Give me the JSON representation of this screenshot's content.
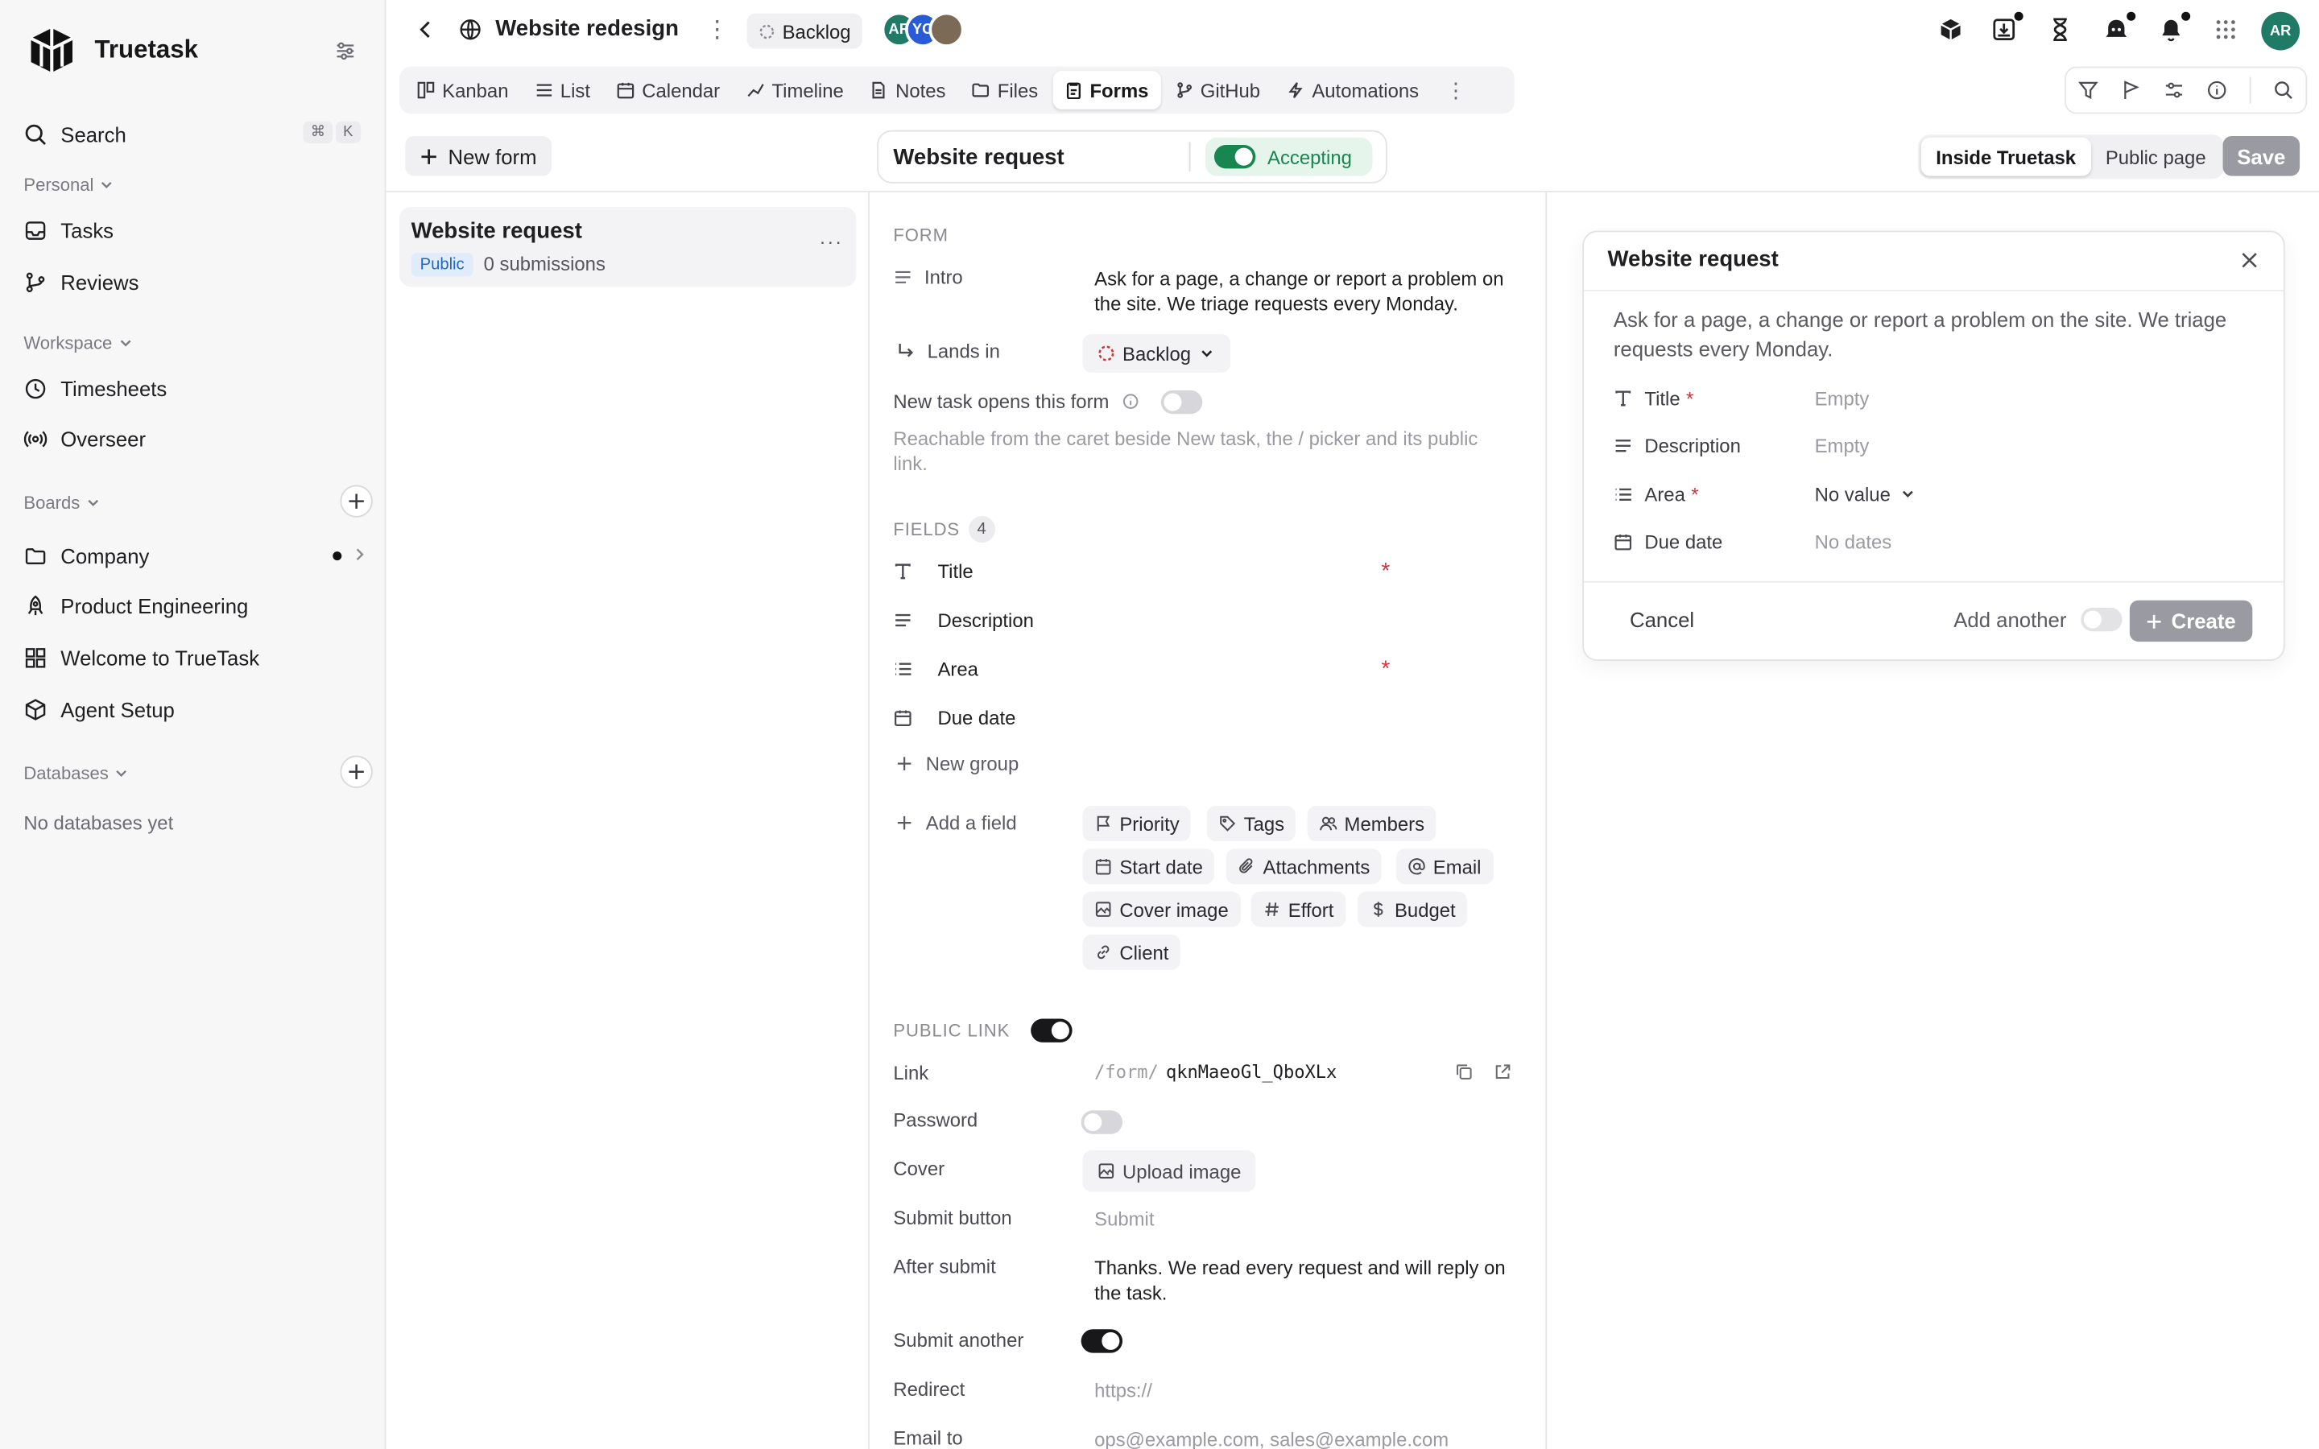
{
  "sidebar": {
    "brand": "Truetask",
    "search": {
      "label": "Search",
      "shortcut_mod": "⌘",
      "shortcut_key": "K"
    },
    "personal": {
      "title": "Personal",
      "items": [
        {
          "label": "Tasks"
        },
        {
          "label": "Reviews"
        }
      ]
    },
    "workspace": {
      "title": "Workspace",
      "items": [
        {
          "label": "Timesheets"
        },
        {
          "label": "Overseer"
        }
      ]
    },
    "boards": {
      "title": "Boards",
      "items": [
        {
          "label": "Company"
        },
        {
          "label": "Product Engineering"
        },
        {
          "label": "Welcome to TrueTask"
        },
        {
          "label": "Agent Setup"
        }
      ]
    },
    "databases": {
      "title": "Databases",
      "empty": "No databases yet"
    }
  },
  "topbar": {
    "title": "Website redesign",
    "status": "Backlog",
    "avatars": [
      {
        "initials": "AR",
        "color": "#1f7a66"
      },
      {
        "initials": "YO",
        "color": "#2a5bd7"
      },
      {
        "initials": "",
        "color": "#7b6a56"
      }
    ],
    "user_initials": "AR",
    "user_color": "#1f7a66"
  },
  "tabs": [
    {
      "label": "Kanban",
      "icon": "kanban-icon"
    },
    {
      "label": "List",
      "icon": "list-icon"
    },
    {
      "label": "Calendar",
      "icon": "calendar-icon"
    },
    {
      "label": "Timeline",
      "icon": "timeline-icon"
    },
    {
      "label": "Notes",
      "icon": "notes-icon"
    },
    {
      "label": "Files",
      "icon": "folder-icon"
    },
    {
      "label": "Forms",
      "icon": "form-icon",
      "active": true
    },
    {
      "label": "GitHub",
      "icon": "branch-icon"
    },
    {
      "label": "Automations",
      "icon": "bolt-icon"
    }
  ],
  "toolbar": {
    "new_form": "New form",
    "form_name": "Website request",
    "accepting": "Accepting",
    "view_inside": "Inside Truetask",
    "view_public": "Public page",
    "save": "Save"
  },
  "forms_list": [
    {
      "title": "Website request",
      "visibility": "Public",
      "submissions": "0 submissions"
    }
  ],
  "editor": {
    "form_section": "FORM",
    "intro_label": "Intro",
    "intro_value": "Ask for a page, a change or report a problem on the site. We triage requests every Monday.",
    "lands_in_label": "Lands in",
    "lands_in_value": "Backlog",
    "new_task_label": "New task opens this form",
    "new_task_help": "Reachable from the caret beside New task, the / picker and its public link.",
    "fields_section": "FIELDS",
    "fields_count": "4",
    "fields": [
      {
        "label": "Title",
        "icon": "text-icon",
        "required": "*"
      },
      {
        "label": "Description",
        "icon": "paragraph-icon",
        "required": ""
      },
      {
        "label": "Area",
        "icon": "list-icon",
        "required": "*"
      },
      {
        "label": "Due date",
        "icon": "calendar-icon",
        "required": ""
      }
    ],
    "new_group": "New group",
    "add_field": "Add a field",
    "chips": [
      "Priority",
      "Tags",
      "Members",
      "Start date",
      "Attachments",
      "Email",
      "Cover image",
      "Effort",
      "Budget",
      "Client"
    ],
    "public_link_section": "PUBLIC LINK",
    "link_label": "Link",
    "link_prefix": "/form/",
    "link_slug": "qknMaeoGl_QboXLx",
    "password_label": "Password",
    "cover_label": "Cover",
    "upload_image": "Upload image",
    "submit_button_label": "Submit button",
    "submit_button_placeholder": "Submit",
    "after_submit_label": "After submit",
    "after_submit_value": "Thanks. We read every request and will reply on the task.",
    "submit_another_label": "Submit another",
    "redirect_label": "Redirect",
    "redirect_placeholder": "https://",
    "email_to_label": "Email to",
    "email_to_placeholder": "ops@example.com, sales@example.com"
  },
  "preview": {
    "title": "Website request",
    "description": "Ask for a page, a change or report a problem on the site. We triage requests every Monday.",
    "fields": [
      {
        "label": "Title",
        "required": "*",
        "value": "Empty"
      },
      {
        "label": "Description",
        "required": "",
        "value": "Empty"
      },
      {
        "label": "Area",
        "required": "*",
        "value": "No value"
      },
      {
        "label": "Due date",
        "required": "",
        "value": "No dates"
      }
    ],
    "cancel": "Cancel",
    "add_another": "Add another",
    "create": "Create"
  },
  "colors": {
    "accent_green": "#17864f",
    "required_red": "#d0343a",
    "public_blue": "#2467c7"
  }
}
